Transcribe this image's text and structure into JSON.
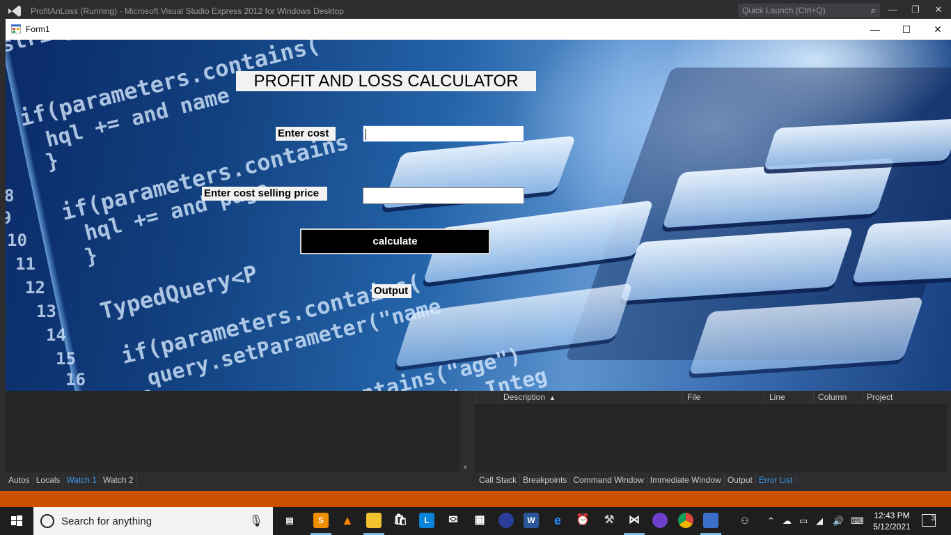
{
  "vs": {
    "title": "ProfitAnLoss (Running) - Microsoft Visual Studio Express 2012 for Windows Desktop",
    "quick_launch": "Quick Launch (Ctrl+Q)"
  },
  "form": {
    "title": "Form1",
    "heading": "PROFIT AND LOSS CALCULATOR",
    "cost_label": "Enter cost",
    "cost_value": "",
    "sp_label": "Enter cost selling price",
    "sp_value": "",
    "calculate_label": "calculate",
    "output_label": "Output"
  },
  "background_code": [
    "string",
    "if(parameters.contains(",
    "hql +=   and name",
    "}",
    "if(parameters.contains",
    "hql +=   and page",
    "}",
    "TypedQuery<P",
    "if(parameters.contains(",
    "query.setParameter(\"name",
    "}",
    "meters.contains(\"age\")",
    "ameter(\"age\", Integ"
  ],
  "background_line_numbers": [
    "8",
    "9",
    "10",
    "11",
    "12",
    "13",
    "14",
    "15",
    "16"
  ],
  "error_list": {
    "columns": [
      "Description",
      "File",
      "Line",
      "Column",
      "Project"
    ]
  },
  "tabs_left": [
    "Autos",
    "Locals",
    "Watch 1",
    "Watch 2"
  ],
  "tabs_left_active": "Watch 1",
  "tabs_right": [
    "Call Stack",
    "Breakpoints",
    "Command Window",
    "Immediate Window",
    "Output",
    "Error List"
  ],
  "tabs_right_active": "Error List",
  "taskbar": {
    "search_placeholder": "Search for anything",
    "time": "12:43 PM",
    "date": "5/12/2021",
    "notification_count": "3"
  },
  "colors": {
    "vs_chrome": "#2d2d30",
    "status_bar": "#ca5100",
    "active_tab": "#3e9bea"
  }
}
